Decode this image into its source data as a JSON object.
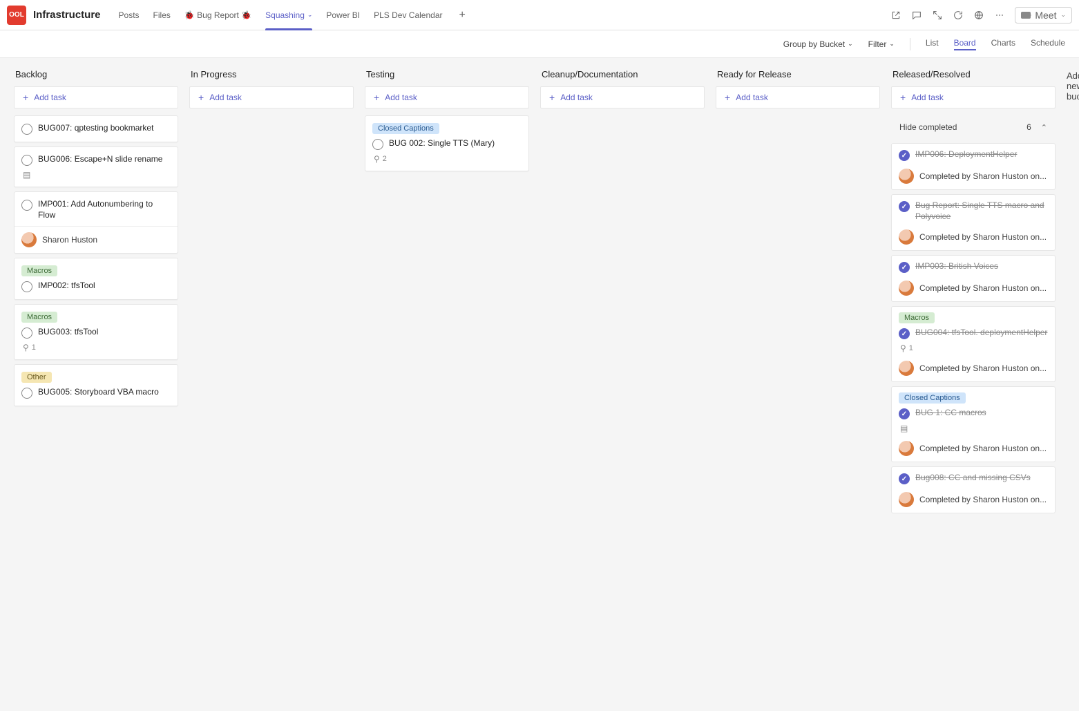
{
  "header": {
    "app_icon_text": "OOL",
    "title": "Infrastructure",
    "tabs": [
      {
        "label": "Posts",
        "active": false
      },
      {
        "label": "Files",
        "active": false
      },
      {
        "label": "🐞 Bug Report 🐞",
        "active": false
      },
      {
        "label": "Squashing",
        "active": true,
        "has_chev": true
      },
      {
        "label": "Power BI",
        "active": false
      },
      {
        "label": "PLS Dev Calendar",
        "active": false
      }
    ],
    "meet_label": "Meet"
  },
  "subbar": {
    "group_label": "Group by Bucket",
    "filter_label": "Filter",
    "views": [
      {
        "label": "List",
        "active": false
      },
      {
        "label": "Board",
        "active": true
      },
      {
        "label": "Charts",
        "active": false
      },
      {
        "label": "Schedule",
        "active": false
      }
    ]
  },
  "board": {
    "add_task_label": "Add task",
    "add_bucket_label": "Add new bucket",
    "buckets": [
      {
        "name": "Backlog"
      },
      {
        "name": "In Progress"
      },
      {
        "name": "Testing"
      },
      {
        "name": "Cleanup/Documentation"
      },
      {
        "name": "Ready for Release"
      },
      {
        "name": "Released/Resolved"
      }
    ],
    "backlog_cards": [
      {
        "title": "BUG007: qptesting bookmarket"
      },
      {
        "title": "BUG006: Escape+N slide rename",
        "has_note_icon": true
      },
      {
        "title": "IMP001: Add Autonumbering to Flow",
        "assignee": "Sharon Huston"
      },
      {
        "tag": "Macros",
        "tag_color": "green",
        "title": "IMP002: tfsTool"
      },
      {
        "tag": "Macros",
        "tag_color": "green",
        "title": "BUG003: tfsTool",
        "attachment_count": "1"
      },
      {
        "tag": "Other",
        "tag_color": "yellow",
        "title": "BUG005: Storyboard VBA macro"
      }
    ],
    "testing_cards": [
      {
        "tag": "Closed Captions",
        "tag_color": "blue",
        "title": "BUG 002: Single TTS (Mary)",
        "attachment_count": "2"
      }
    ],
    "completed": {
      "hide_label": "Hide completed",
      "count": "6",
      "items": [
        {
          "title": "IMP006: DeploymentHelper",
          "completed_by": "Completed by Sharon Huston on..."
        },
        {
          "title": "Bug Report: Single TTS macro and Polyvoice",
          "completed_by": "Completed by Sharon Huston on..."
        },
        {
          "title": "IMP003: British Voices",
          "completed_by": "Completed by Sharon Huston on..."
        },
        {
          "tag": "Macros",
          "tag_color": "green",
          "title": "BUG004: tfsTool. deploymentHelper",
          "attachment_count": "1",
          "completed_by": "Completed by Sharon Huston on..."
        },
        {
          "tag": "Closed Captions",
          "tag_color": "blue",
          "title": "BUG 1: CC macros",
          "has_note_icon": true,
          "completed_by": "Completed by Sharon Huston on..."
        },
        {
          "title": "Bug008: CC and missing CSVs",
          "completed_by": "Completed by Sharon Huston on..."
        }
      ]
    }
  }
}
